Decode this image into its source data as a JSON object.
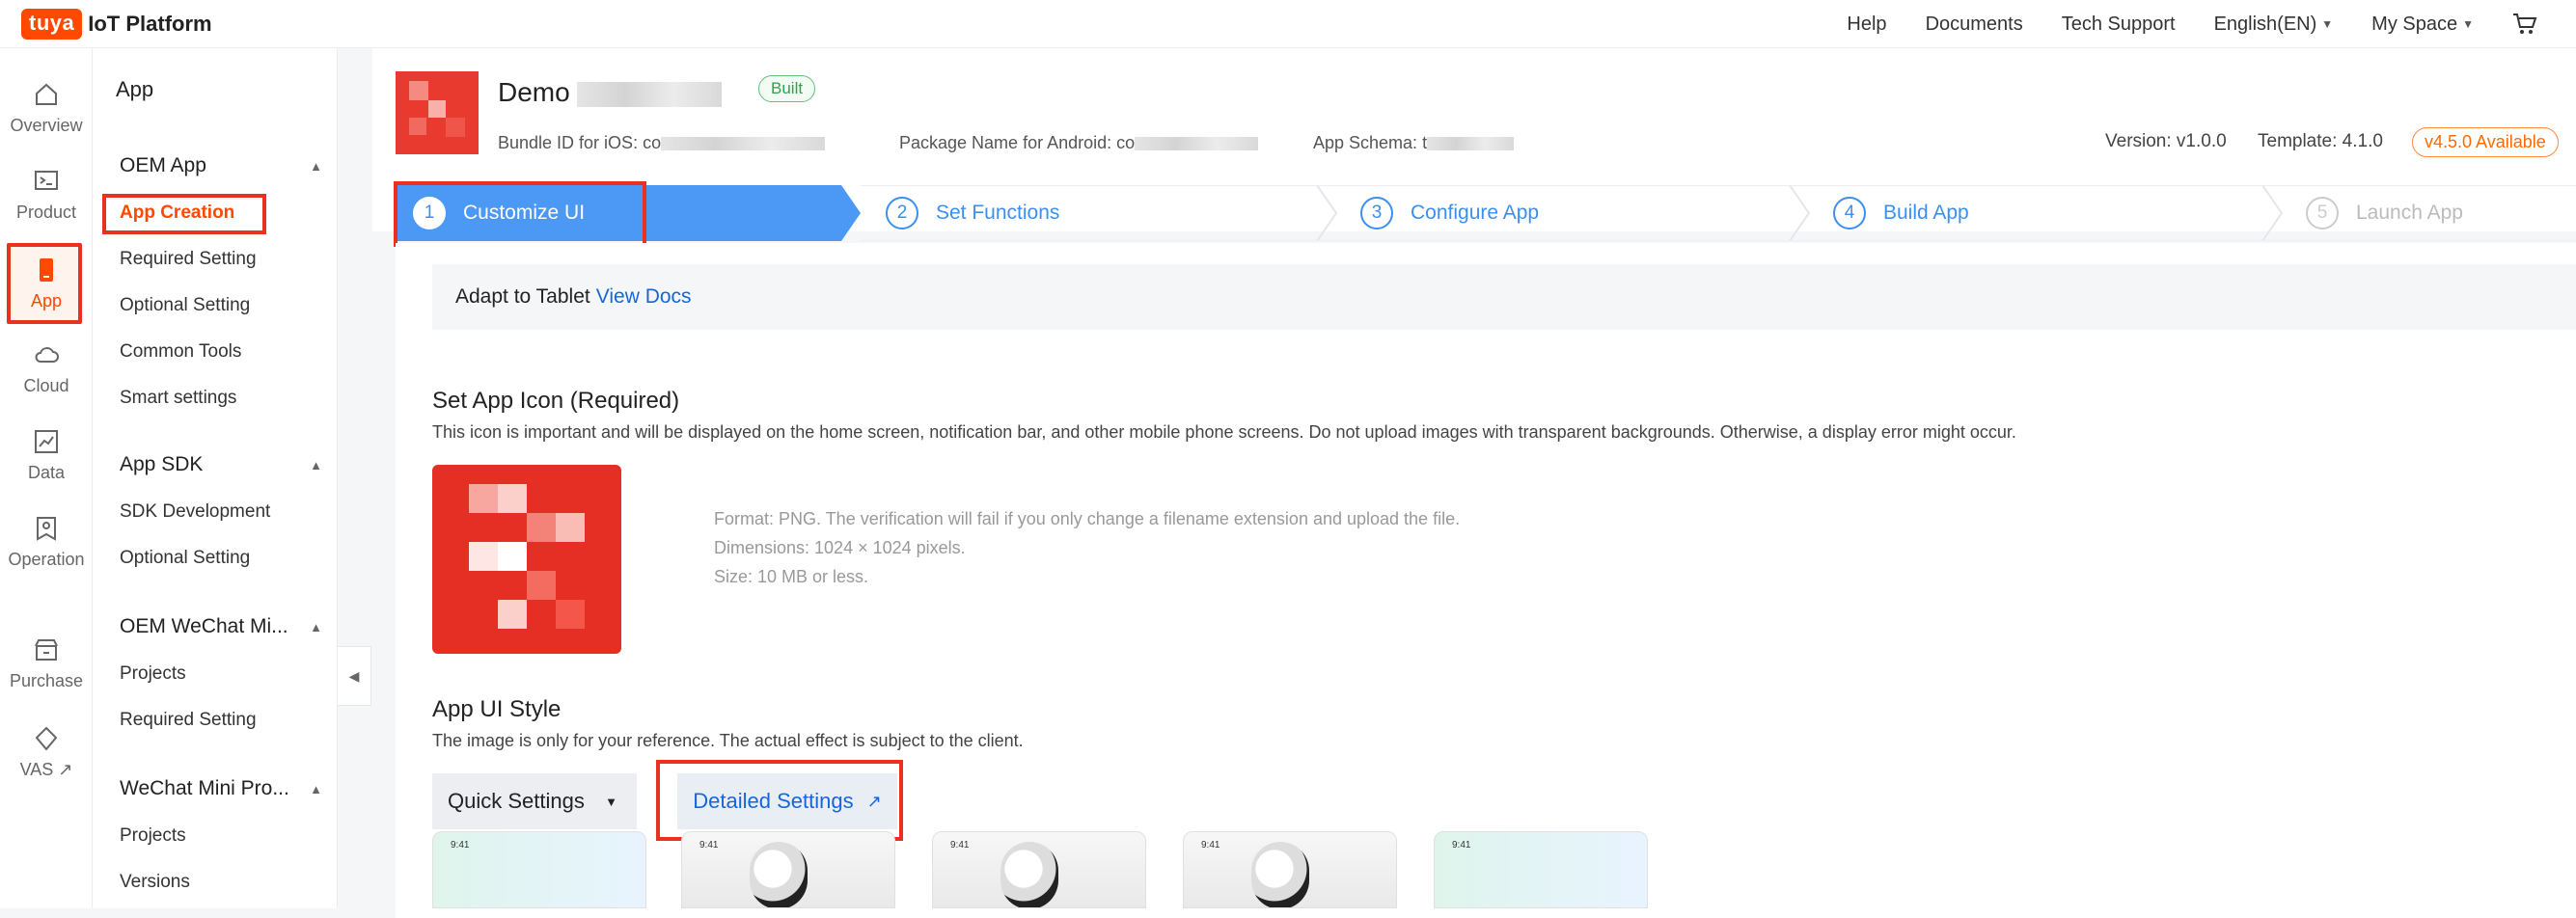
{
  "brand": {
    "logo_text": "tuya",
    "title": "IoT Platform",
    "color": "#ff4800"
  },
  "topnav": {
    "help": "Help",
    "documents": "Documents",
    "tech_support": "Tech Support",
    "language": "English(EN)",
    "my_space": "My Space",
    "cart_icon": "cart-icon"
  },
  "rail": [
    {
      "label": "Overview",
      "icon": "home-icon"
    },
    {
      "label": "Product",
      "icon": "terminal-icon"
    },
    {
      "label": "App",
      "icon": "phone-icon"
    },
    {
      "label": "Cloud",
      "icon": "cloud-icon"
    },
    {
      "label": "Data",
      "icon": "chart-icon"
    },
    {
      "label": "Operation",
      "icon": "badge-icon"
    },
    {
      "label": "Purchase",
      "icon": "shop-icon"
    },
    {
      "label": "VAS",
      "icon": "diamond-icon"
    }
  ],
  "sidemenu": {
    "head": "App",
    "groups": [
      {
        "title": "OEM App",
        "items": [
          "App Creation",
          "Required Setting",
          "Optional Setting",
          "Common Tools",
          "Smart settings"
        ]
      },
      {
        "title": "App SDK",
        "items": [
          "SDK Development",
          "Optional Setting"
        ]
      },
      {
        "title": "OEM WeChat Mi...",
        "items": [
          "Projects",
          "Required Setting"
        ]
      },
      {
        "title": "WeChat Mini Pro...",
        "items": [
          "Projects",
          "Versions"
        ]
      }
    ]
  },
  "app": {
    "name": "Demo",
    "status": "Built",
    "bundle_label": "Bundle ID for iOS: co",
    "package_label": "Package Name for Android: co",
    "schema_label": "App Schema: t",
    "version": "Version: v1.0.0",
    "template": "Template: 4.1.0",
    "available": "v4.5.0 Available"
  },
  "steps": [
    {
      "num": "1",
      "label": "Customize UI",
      "state": "active"
    },
    {
      "num": "2",
      "label": "Set Functions",
      "state": "normal"
    },
    {
      "num": "3",
      "label": "Configure App",
      "state": "normal"
    },
    {
      "num": "4",
      "label": "Build App",
      "state": "normal"
    },
    {
      "num": "5",
      "label": "Launch App",
      "state": "disabled"
    }
  ],
  "content": {
    "tablet_text": "Adapt to Tablet",
    "tablet_link": "View Docs",
    "icon_title": "Set App Icon (Required)",
    "icon_desc": "This icon is important and will be displayed on the home screen, notification bar, and other mobile phone screens. Do not upload images with transparent backgrounds. Otherwise, a display error might occur.",
    "format": "Format: PNG. The verification will fail if you only change a filename extension and upload the file.",
    "dimensions": "Dimensions: 1024 × 1024 pixels.",
    "size": "Size: 10 MB or less.",
    "ui_title": "App UI Style",
    "ui_desc": "The image is only for your reference. The actual effect is subject to the client.",
    "quick_settings": "Quick Settings",
    "detailed_settings": "Detailed Settings",
    "thumb_time": "9:41"
  },
  "colors": {
    "accent": "#3b8ff3",
    "orange": "#ff4800",
    "highlight_box": "#e8311f",
    "link": "#1766d8"
  }
}
